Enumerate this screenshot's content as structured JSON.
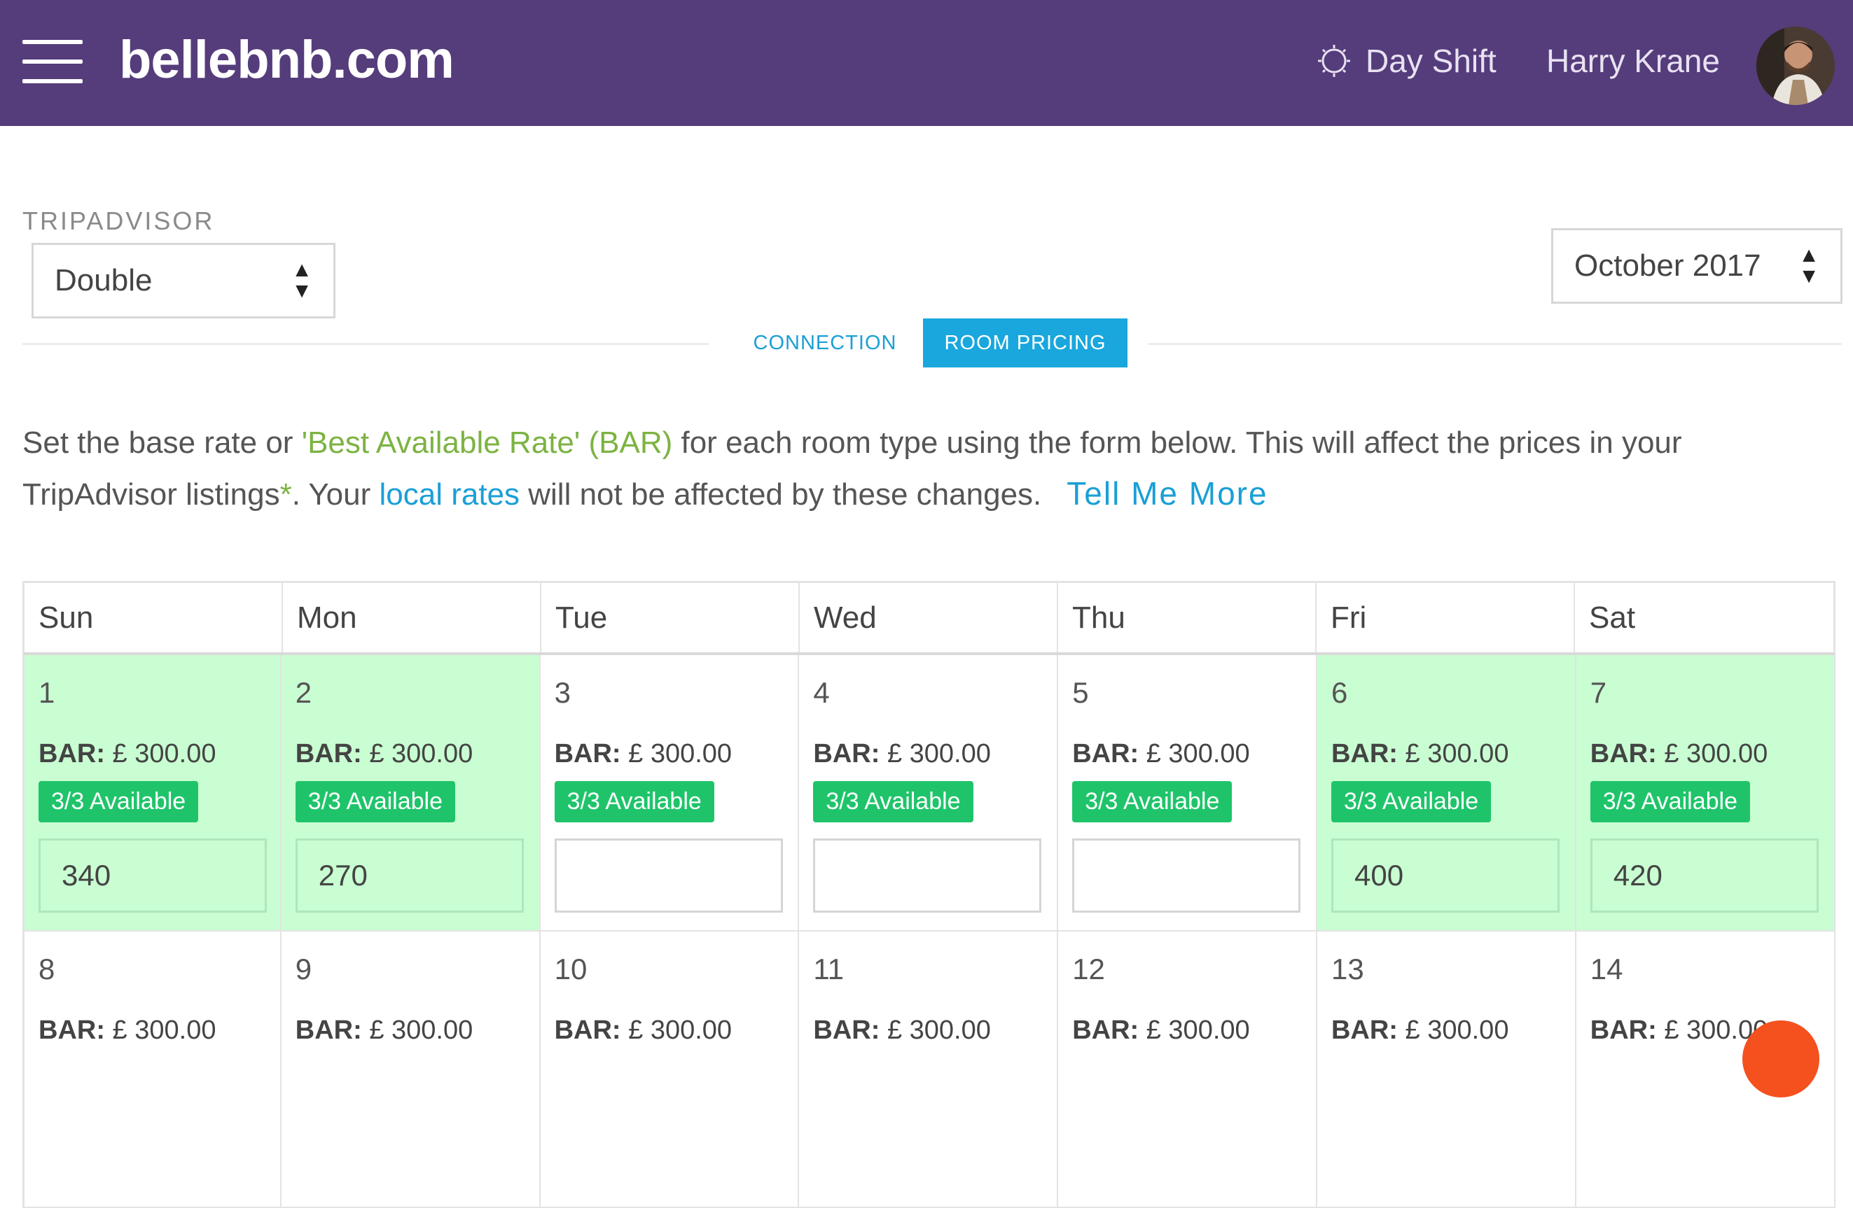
{
  "header": {
    "brand": "bellebnb.com",
    "shift_label": "Day Shift",
    "user_name": "Harry Krane"
  },
  "channel_label": "TRIPADVISOR",
  "room_select": {
    "value": "Double"
  },
  "month_select": {
    "value": "October 2017"
  },
  "tabs": [
    {
      "label": "CONNECTION",
      "active": false
    },
    {
      "label": "ROOM PRICING",
      "active": true
    }
  ],
  "intro": {
    "part1": "Set the base rate or ",
    "bar_term": "'Best Available Rate' (BAR)",
    "part2": " for each room type using the form below. This will affect the prices in your TripAdvisor listings",
    "asterisk": "*",
    "part3": ". Your ",
    "local_rates_link": "local rates",
    "part4": " will not be affected by these changes.",
    "tell_more_link": "Tell Me More"
  },
  "calendar": {
    "weekdays": [
      "Sun",
      "Mon",
      "Tue",
      "Wed",
      "Thu",
      "Fri",
      "Sat"
    ],
    "bar_label": "BAR:",
    "week1": [
      {
        "day": "1",
        "bar": "£ 300.00",
        "availability": "3/3 Available",
        "rate": "340"
      },
      {
        "day": "2",
        "bar": "£ 300.00",
        "availability": "3/3 Available",
        "rate": "270"
      },
      {
        "day": "3",
        "bar": "£ 300.00",
        "availability": "3/3 Available",
        "rate": ""
      },
      {
        "day": "4",
        "bar": "£ 300.00",
        "availability": "3/3 Available",
        "rate": ""
      },
      {
        "day": "5",
        "bar": "£ 300.00",
        "availability": "3/3 Available",
        "rate": ""
      },
      {
        "day": "6",
        "bar": "£ 300.00",
        "availability": "3/3 Available",
        "rate": "400"
      },
      {
        "day": "7",
        "bar": "£ 300.00",
        "availability": "3/3 Available",
        "rate": "420"
      }
    ],
    "week2": [
      {
        "day": "8",
        "bar": "£ 300.00"
      },
      {
        "day": "9",
        "bar": "£ 300.00"
      },
      {
        "day": "10",
        "bar": "£ 300.00"
      },
      {
        "day": "11",
        "bar": "£ 300.00"
      },
      {
        "day": "12",
        "bar": "£ 300.00"
      },
      {
        "day": "13",
        "bar": "£ 300.00"
      },
      {
        "day": "14",
        "bar": "£ 300.00"
      }
    ]
  },
  "colors": {
    "header_bg": "#553c7b",
    "accent_blue": "#19a7dd",
    "highlight_green": "#c9fed2",
    "badge_green": "#1fc46a",
    "fab": "#f4511e"
  }
}
